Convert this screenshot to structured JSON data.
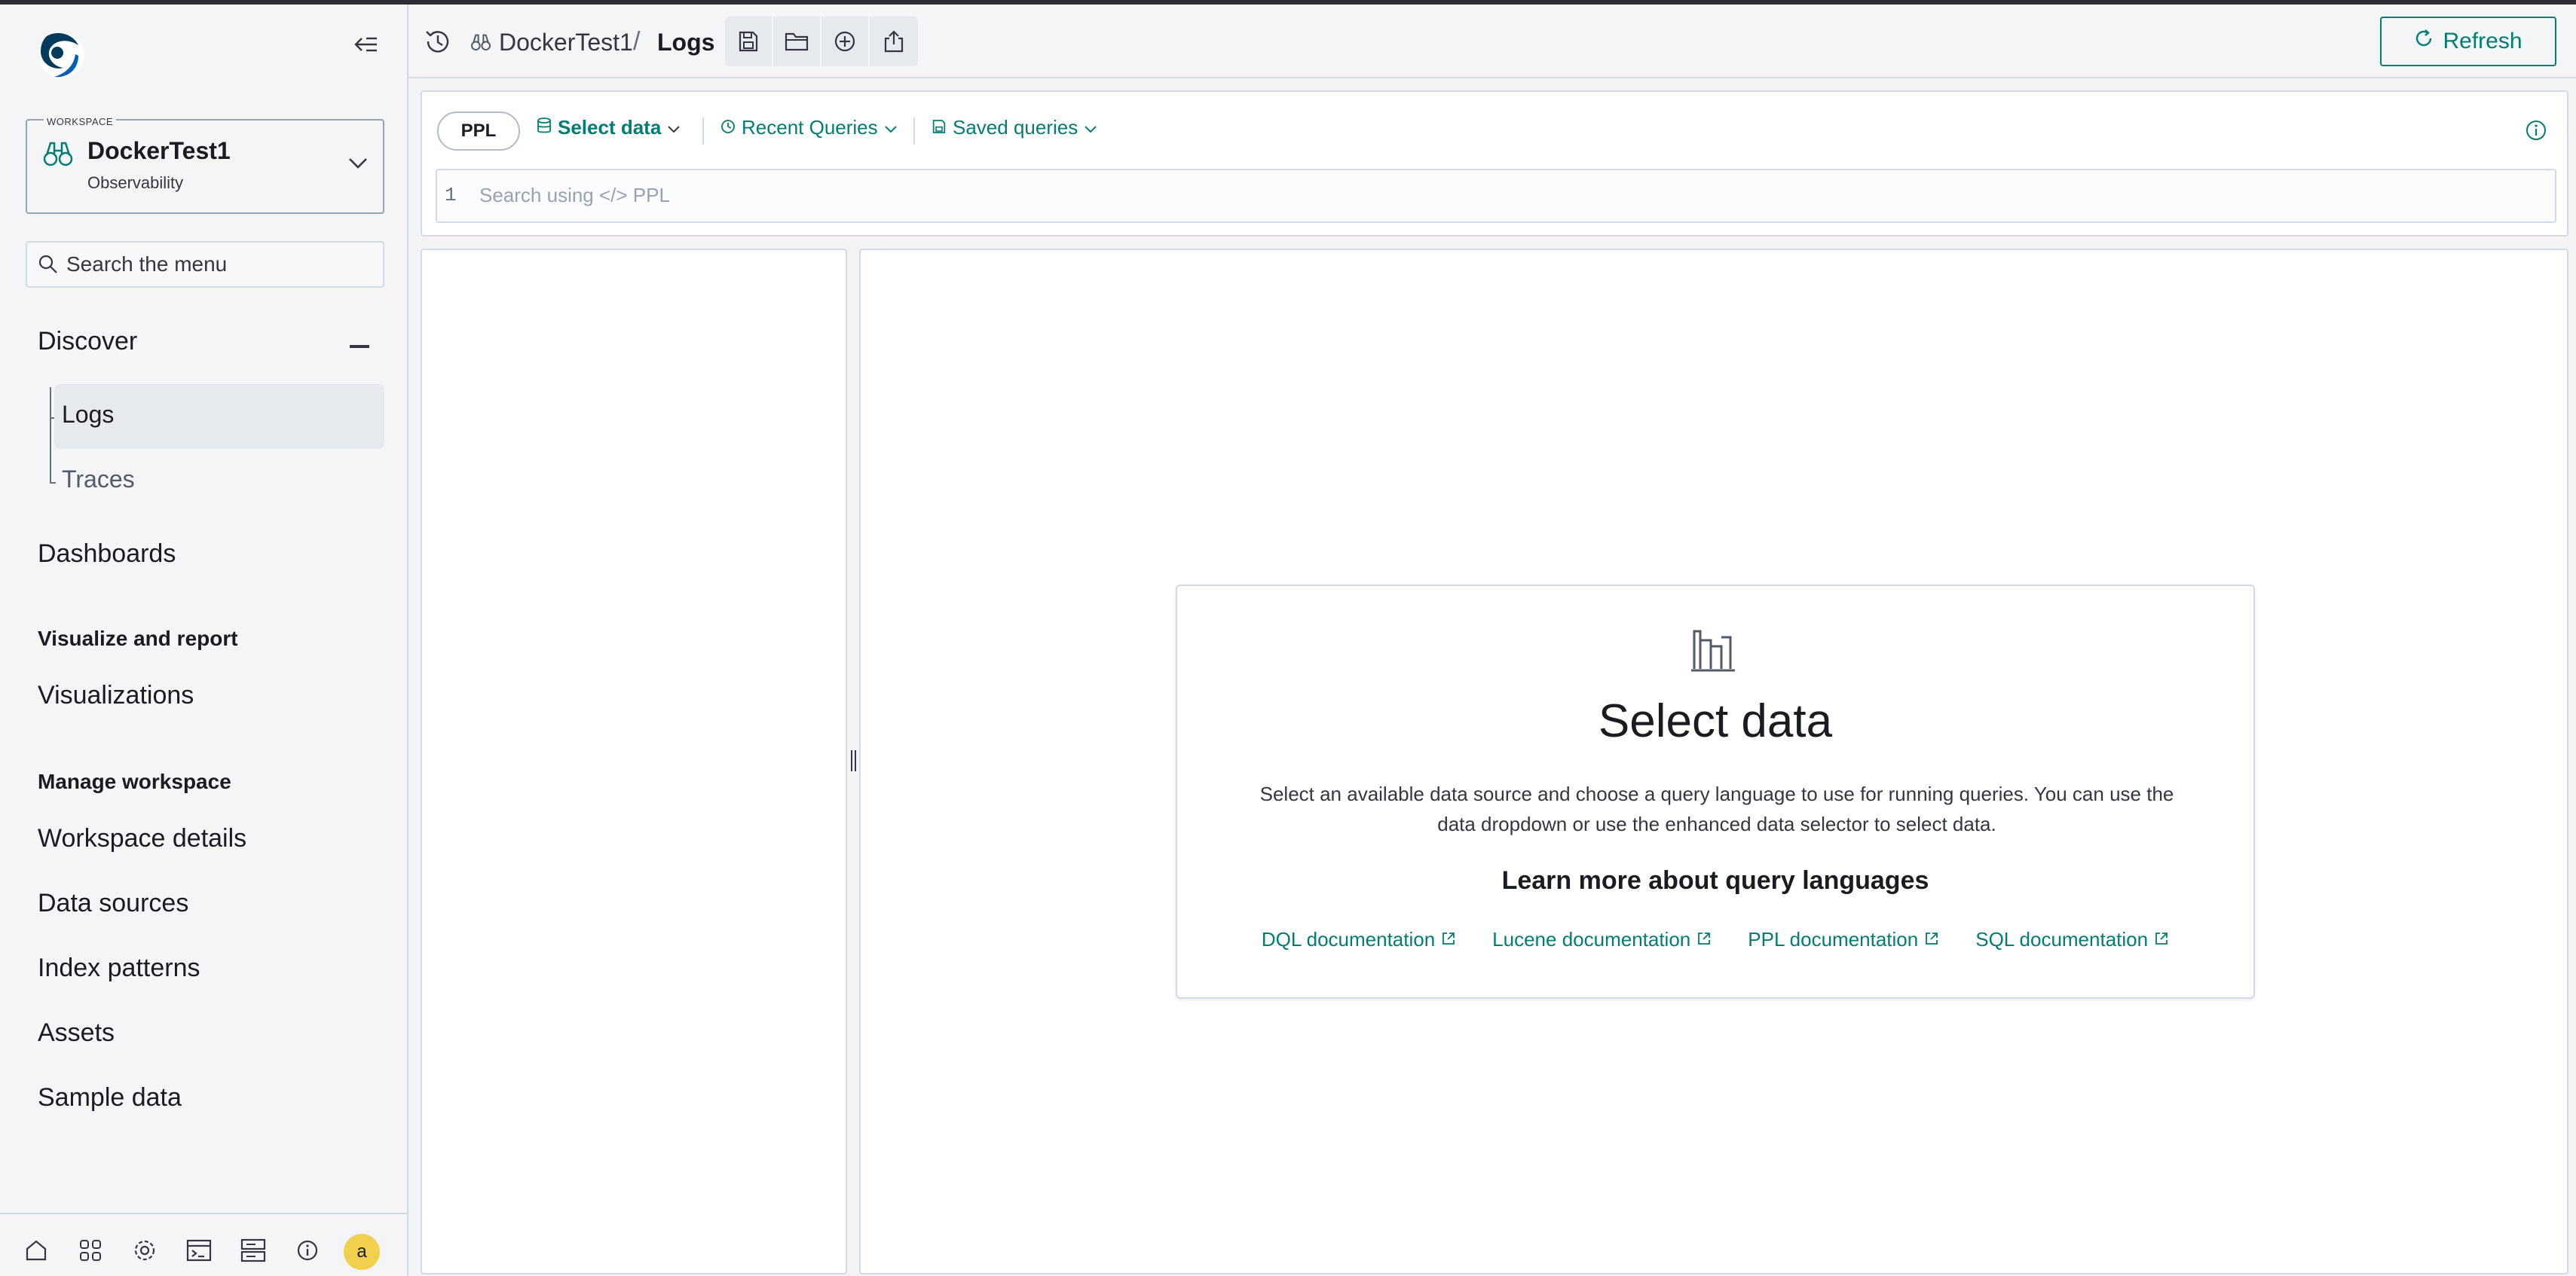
{
  "colors": {
    "accent": "#017d73",
    "sidebar_bg": "#f4f5f7",
    "page_bg": "#f1f3f5",
    "active_item_bg": "#e6e9ed",
    "avatar_bg": "#f0d04c"
  },
  "sidebar": {
    "logo_icon": "opensearch-logo-icon",
    "collapse_icon": "collapse-menu-icon",
    "workspace": {
      "caption": "WORKSPACE",
      "icon": "binoculars-icon",
      "name": "DockerTest1",
      "type": "Observability"
    },
    "search_placeholder": "Search the menu",
    "discover": {
      "label": "Discover",
      "children": [
        {
          "label": "Logs",
          "active": true
        },
        {
          "label": "Traces",
          "active": false
        }
      ]
    },
    "dashboards": "Dashboards",
    "section_visualize": "Visualize and report",
    "visualizations": "Visualizations",
    "section_manage": "Manage workspace",
    "workspace_details": "Workspace details",
    "data_sources": "Data sources",
    "index_patterns": "Index patterns",
    "assets": "Assets",
    "sample_data": "Sample data",
    "footer": {
      "icons": [
        "home-icon",
        "apps-icon",
        "settings-icon",
        "dev-tools-icon",
        "console-icon",
        "info-icon"
      ],
      "avatar_initial": "a"
    }
  },
  "header": {
    "breadcrumb_workspace": "DockerTest1",
    "breadcrumb_sep": "/",
    "breadcrumb_page": "Logs",
    "toolbar_icons": [
      "save-icon",
      "open-icon",
      "new-icon",
      "share-icon"
    ],
    "refresh_label": "Refresh"
  },
  "query": {
    "language": "PPL",
    "select_data": "Select data",
    "recent_queries": "Recent Queries",
    "saved_queries": "Saved queries",
    "line_number": "1",
    "placeholder": "Search using </> PPL"
  },
  "empty_state": {
    "title": "Select data",
    "description": "Select an available data source and choose a query language to use for running queries. You can use the data dropdown or use the enhanced data selector to select data.",
    "subtitle": "Learn more about query languages",
    "links": [
      "DQL documentation",
      "Lucene documentation",
      "PPL documentation",
      "SQL documentation"
    ]
  }
}
